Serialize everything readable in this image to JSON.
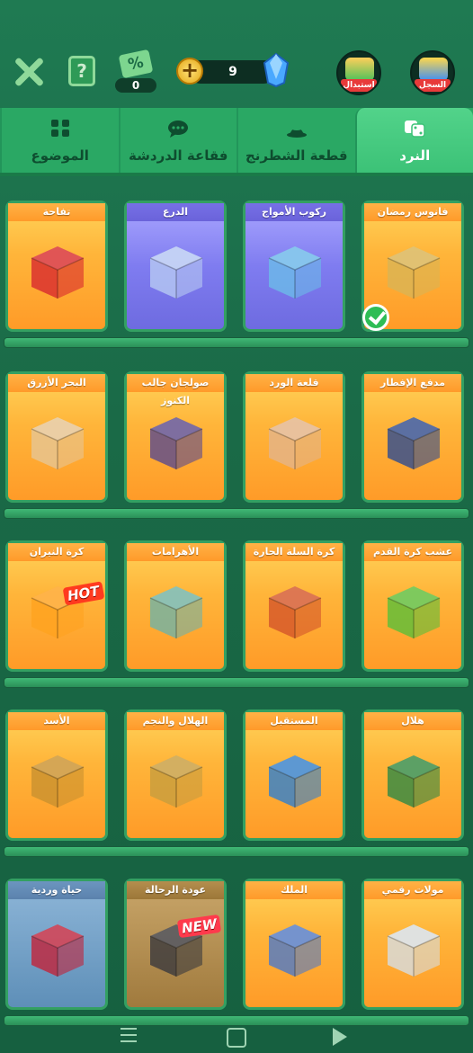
{
  "colors": {
    "accent": "#2aa864",
    "card_orange": "#ffb53a",
    "card_purple": "#7f7cf0",
    "check": "#2fbd55"
  },
  "topbar": {
    "promo_icon_text": "%",
    "promo_count": "0",
    "gem_count": "9",
    "help_symbol": "?",
    "avatar_left_label": "استبدال",
    "avatar_right_label": "السجل"
  },
  "tabs": [
    {
      "label": "النرد",
      "icon": "dice-icon",
      "active": true
    },
    {
      "label": "قطعة الشطرنج",
      "icon": "pawn-icon",
      "active": false
    },
    {
      "label": "فقاعة الدردشة",
      "icon": "chat-bubble-icon",
      "active": false
    },
    {
      "label": "الموضوع",
      "icon": "theme-grid-icon",
      "active": false
    }
  ],
  "rows": [
    [
      {
        "title": "فانوس رمضان",
        "style": "orange",
        "cube": "#d9b455",
        "selected": true
      },
      {
        "title": "ركوب الأمواج",
        "style": "purple",
        "cube": "#6bbbe8"
      },
      {
        "title": "الدرع",
        "style": "purple",
        "cube": "#b7c9f2"
      },
      {
        "title": "تفاحة",
        "style": "orange",
        "cube": "#d8292f"
      }
    ],
    [
      {
        "title": "مدفع الإفطار",
        "style": "orange",
        "cube": "#2d4b92"
      },
      {
        "title": "قلعة الورد",
        "style": "orange",
        "cube": "#e3b48b"
      },
      {
        "title": "صولجان جالب الكنوز",
        "style": "orange",
        "cube": "#5a4a8f"
      },
      {
        "title": "البحر الأزرق",
        "style": "orange",
        "cube": "#e6c595"
      }
    ],
    [
      {
        "title": "عشب كرة القدم",
        "style": "orange",
        "cube": "#5abf3a"
      },
      {
        "title": "كرة السلة الحارة",
        "style": "orange",
        "cube": "#d4552b"
      },
      {
        "title": "الأهرامات",
        "style": "orange",
        "cube": "#6fb3a8"
      },
      {
        "title": "كرة النيران",
        "style": "orange",
        "cube": "#ffa21f",
        "tag": "HOT"
      }
    ],
    [
      {
        "title": "هلال",
        "style": "orange",
        "cube": "#2e8a45"
      },
      {
        "title": "المستقبل",
        "style": "orange",
        "cube": "#2f7fd0"
      },
      {
        "title": "الهلال والنجم",
        "style": "orange",
        "cube": "#c79d3f"
      },
      {
        "title": "الأسد",
        "style": "orange",
        "cube": "#c9912f"
      }
    ],
    [
      {
        "title": "مولات رقمي",
        "style": "orange",
        "cube": "#d6dde3"
      },
      {
        "title": "الملك",
        "style": "orange",
        "cube": "#4e79c9"
      },
      {
        "title": "عودة الرحالة",
        "style": "brown",
        "cube": "#3b3a3d",
        "tag": "NEW"
      },
      {
        "title": "حياة وردية",
        "style": "grey",
        "cube": "#c2233a"
      }
    ]
  ]
}
